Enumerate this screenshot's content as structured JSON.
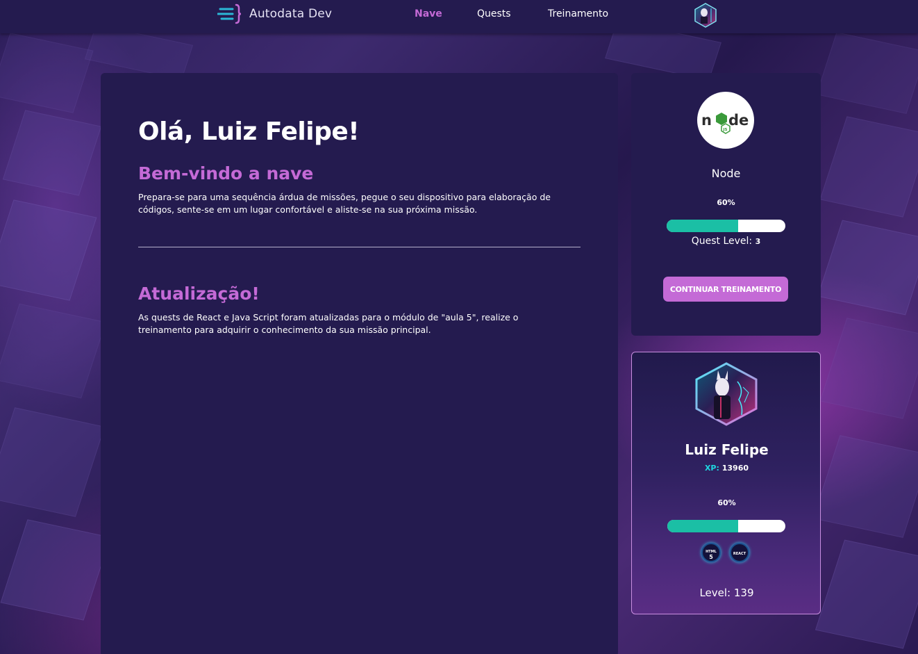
{
  "header": {
    "brand": "Autodata Dev",
    "nav": [
      {
        "label": "Nave",
        "active": true
      },
      {
        "label": "Quests",
        "active": false
      },
      {
        "label": "Treinamento",
        "active": false
      }
    ]
  },
  "main": {
    "greeting": "Olá, Luiz Felipe!",
    "welcome_title": "Bem-vindo a nave",
    "welcome_text": "Prepara-se para uma sequência árdua de missões, pegue o seu dispositivo para elaboração de códigos, sente-se em um lugar confortável e aliste-se na sua próxima missão.",
    "update_title": "Atualização!",
    "update_text": "As quests de React e Java Script foram atualizadas para o módulo de \"aula 5\", realize o treinamento para adquirir o conhecimento da sua missão principal."
  },
  "course_card": {
    "course_name": "Node",
    "progress_label": "60%",
    "progress": 0.6,
    "quest_level_label": "Quest Level:",
    "quest_level_value": "3",
    "button_label": "CONTINUAR TREINAMENTO"
  },
  "profile_card": {
    "name": "Luiz Felipe",
    "xp_label": "XP:",
    "xp_value": "13960",
    "progress_label": "60%",
    "progress": 0.6,
    "skills": [
      {
        "icon": "html5-icon",
        "top": "HTML",
        "bottom": "5"
      },
      {
        "icon": "react-icon",
        "top": "REACT",
        "bottom": ""
      }
    ],
    "level_label": "Level:",
    "level_value": "139"
  },
  "colors": {
    "accent": "#c46ad6",
    "progress": "#1bbfa5",
    "panel": "#241b4f",
    "xp": "#1fd6e0"
  }
}
